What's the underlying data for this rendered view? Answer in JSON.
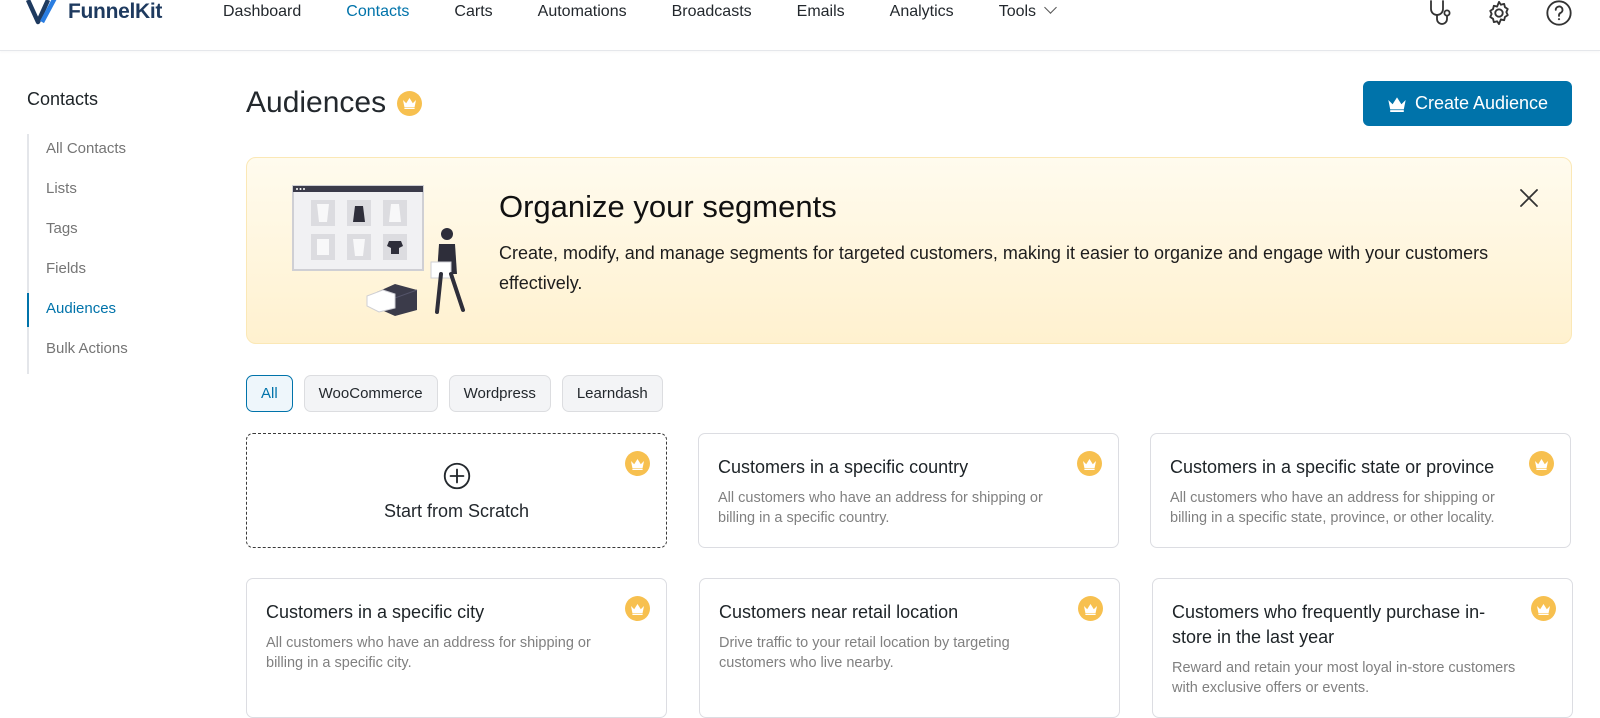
{
  "brand": {
    "name": "FunnelKit"
  },
  "nav": {
    "items": [
      "Dashboard",
      "Contacts",
      "Carts",
      "Automations",
      "Broadcasts",
      "Emails",
      "Analytics",
      "Tools"
    ],
    "active": "Contacts"
  },
  "sidebar": {
    "title": "Contacts",
    "items": [
      "All Contacts",
      "Lists",
      "Tags",
      "Fields",
      "Audiences",
      "Bulk Actions"
    ],
    "active": "Audiences"
  },
  "header": {
    "title": "Audiences",
    "create_label": "Create Audience"
  },
  "banner": {
    "title": "Organize your segments",
    "text": "Create, modify, and manage segments for targeted customers, making it easier to organize and engage with your customers effectively."
  },
  "filters": {
    "items": [
      "All",
      "WooCommerce",
      "Wordpress",
      "Learndash"
    ],
    "active": "All"
  },
  "cards": {
    "scratch_label": "Start from Scratch",
    "items": [
      {
        "title": "Customers in a specific country",
        "desc": "All customers who have an address for shipping or billing in a specific country."
      },
      {
        "title": "Customers in a specific state or province",
        "desc": "All customers who have an address for shipping or billing in a specific state, province, or other locality."
      },
      {
        "title": "Customers in a specific city",
        "desc": "All customers who have an address for shipping or billing in a specific city."
      },
      {
        "title": "Customers near retail location",
        "desc": "Drive traffic to your retail location by targeting customers who live nearby."
      },
      {
        "title": "Customers who frequently purchase in-store in the last year",
        "desc": "Reward and retain your most loyal in-store customers with exclusive offers or events."
      }
    ]
  },
  "colors": {
    "accent": "#0073aa",
    "crown": "#f7c04f",
    "banner_bg": "#fff3d6"
  },
  "icons": [
    "stethoscope-icon",
    "gear-icon",
    "help-icon",
    "crown-icon",
    "close-icon",
    "plus-circle-icon",
    "chevron-down-icon"
  ]
}
